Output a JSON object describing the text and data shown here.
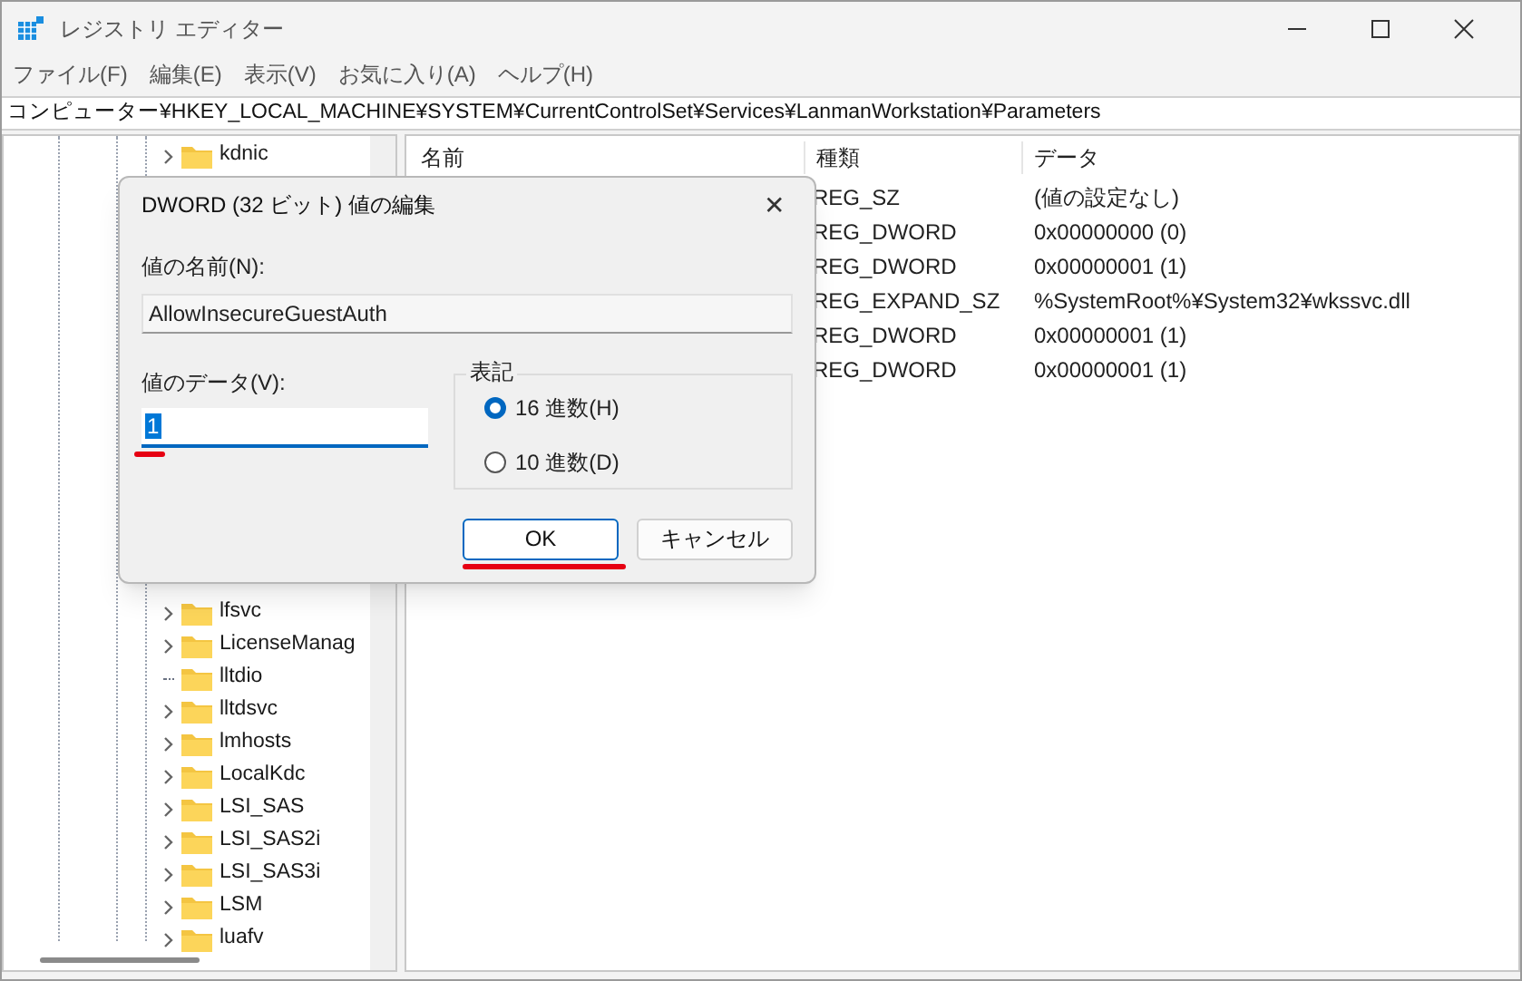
{
  "window": {
    "title": "レジストリ エディター"
  },
  "menu": [
    "ファイル(F)",
    "編集(E)",
    "表示(V)",
    "お気に入り(A)",
    "ヘルプ(H)"
  ],
  "address": "コンピューター¥HKEY_LOCAL_MACHINE¥SYSTEM¥CurrentControlSet¥Services¥LanmanWorkstation¥Parameters",
  "tree_top": [
    {
      "label": "kdnic",
      "expandable": true
    }
  ],
  "tree_bottom": [
    {
      "label": "lfsvc",
      "expandable": true
    },
    {
      "label": "LicenseManag",
      "expandable": true
    },
    {
      "label": "lltdio",
      "expandable": false
    },
    {
      "label": "lltdsvc",
      "expandable": true
    },
    {
      "label": "lmhosts",
      "expandable": true
    },
    {
      "label": "LocalKdc",
      "expandable": true
    },
    {
      "label": "LSI_SAS",
      "expandable": true
    },
    {
      "label": "LSI_SAS2i",
      "expandable": true
    },
    {
      "label": "LSI_SAS3i",
      "expandable": true
    },
    {
      "label": "LSM",
      "expandable": true
    },
    {
      "label": "luafv",
      "expandable": true
    }
  ],
  "list": {
    "columns": [
      "名前",
      "種類",
      "データ"
    ],
    "rows": [
      {
        "type": "REG_SZ",
        "data": "(値の設定なし)"
      },
      {
        "type": "REG_DWORD",
        "data": "0x00000000 (0)"
      },
      {
        "type": "REG_DWORD",
        "data": "0x00000001 (1)"
      },
      {
        "type": "REG_EXPAND_SZ",
        "data": "%SystemRoot%¥System32¥wkssvc.dll"
      },
      {
        "type": "REG_DWORD",
        "data": "0x00000001 (1)"
      },
      {
        "type": "REG_DWORD",
        "data": "0x00000001 (1)"
      }
    ]
  },
  "dialog": {
    "title": "DWORD (32 ビット) 値の編集",
    "close": "✕",
    "name_label": "値の名前(N):",
    "name_value": "AllowInsecureGuestAuth",
    "data_label": "値のデータ(V):",
    "data_value": "1",
    "base_label": "表記",
    "bases": [
      {
        "label": "16 進数(H)",
        "selected": true
      },
      {
        "label": "10 進数(D)",
        "selected": false
      }
    ],
    "buttons": [
      {
        "label": "OK",
        "default": true
      },
      {
        "label": "キャンセル",
        "default": false
      }
    ]
  }
}
